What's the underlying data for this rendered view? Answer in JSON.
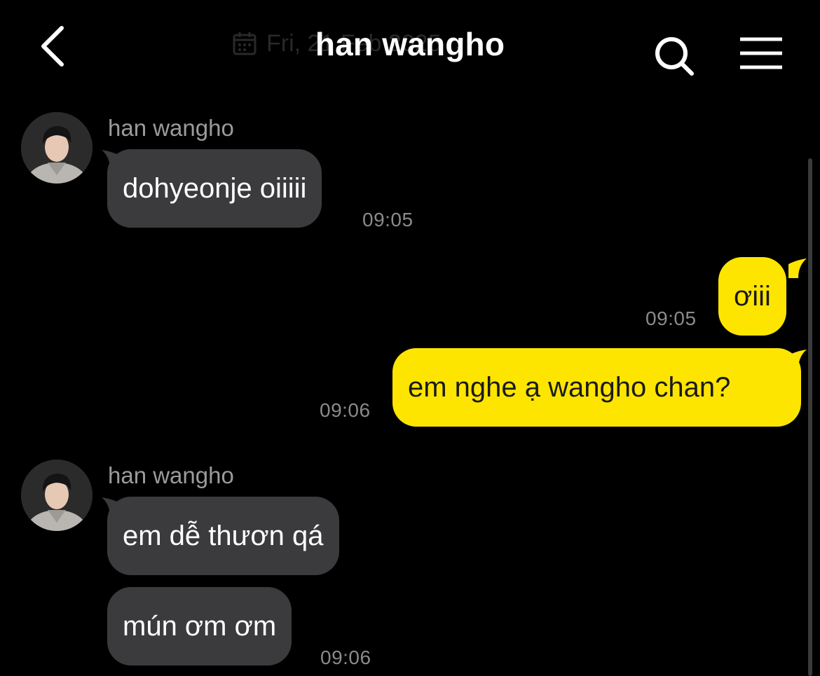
{
  "header": {
    "title": "han wangho",
    "date_text": "Fri, 21 Feb 2025",
    "back_label": "back",
    "search_label": "search",
    "menu_label": "menu"
  },
  "colors": {
    "background": "#000000",
    "incoming_bubble": "#3b3b3d",
    "outgoing_bubble": "#fee500",
    "timestamp": "#8a8a8a",
    "sender_name": "#9b9b9b"
  },
  "messages": [
    {
      "direction": "in",
      "sender": "han wangho",
      "text": "dohyeonje oiiiii",
      "time": "09:05"
    },
    {
      "direction": "out",
      "text": "ơiii",
      "time": "09:05"
    },
    {
      "direction": "out",
      "text": "em nghe ạ wangho chan?",
      "time": "09:06"
    },
    {
      "direction": "in",
      "sender": "han wangho",
      "text": "em dễ thươn qá",
      "time": ""
    },
    {
      "direction": "in",
      "text": "mún ơm ơm",
      "time": "09:06"
    }
  ]
}
